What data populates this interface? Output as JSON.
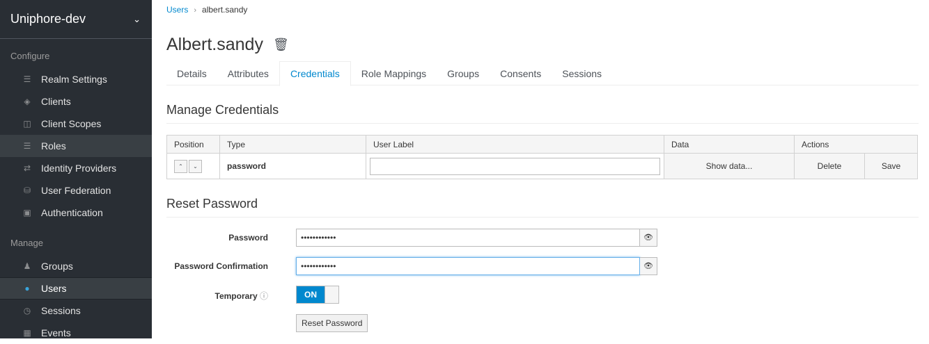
{
  "realm": "Uniphore-dev",
  "sidebar": {
    "configure_label": "Configure",
    "manage_label": "Manage",
    "configure_items": [
      {
        "label": "Realm Settings",
        "icon": "sliders-icon"
      },
      {
        "label": "Clients",
        "icon": "cube-icon"
      },
      {
        "label": "Client Scopes",
        "icon": "cubes-icon"
      },
      {
        "label": "Roles",
        "icon": "list-icon"
      },
      {
        "label": "Identity Providers",
        "icon": "exchange-icon"
      },
      {
        "label": "User Federation",
        "icon": "database-icon"
      },
      {
        "label": "Authentication",
        "icon": "lock-icon"
      }
    ],
    "manage_items": [
      {
        "label": "Groups",
        "icon": "users-icon"
      },
      {
        "label": "Users",
        "icon": "user-icon"
      },
      {
        "label": "Sessions",
        "icon": "clock-icon"
      },
      {
        "label": "Events",
        "icon": "calendar-icon"
      }
    ]
  },
  "breadcrumb": {
    "root": "Users",
    "current": "albert.sandy"
  },
  "page_title": "Albert.sandy",
  "tabs": [
    "Details",
    "Attributes",
    "Credentials",
    "Role Mappings",
    "Groups",
    "Consents",
    "Sessions"
  ],
  "active_tab": "Credentials",
  "manage_credentials": {
    "heading": "Manage Credentials",
    "columns": [
      "Position",
      "Type",
      "User Label",
      "Data",
      "Actions"
    ],
    "row": {
      "type": "password",
      "user_label": "",
      "data_button": "Show data...",
      "delete_button": "Delete",
      "save_button": "Save"
    }
  },
  "reset_password": {
    "heading": "Reset Password",
    "password_label": "Password",
    "password_value": "••••••••••••",
    "confirm_label": "Password Confirmation",
    "confirm_value": "••••••••••••",
    "temporary_label": "Temporary",
    "temporary_state": "ON",
    "button": "Reset Password"
  },
  "colors": {
    "accent": "#0088ce",
    "sidebar_bg": "#292e34"
  }
}
